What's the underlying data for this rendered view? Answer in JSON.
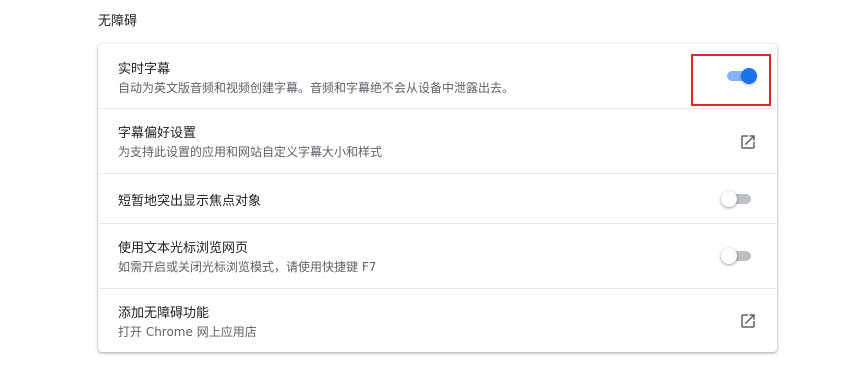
{
  "section": {
    "title": "无障碍"
  },
  "rows": [
    {
      "title": "实时字幕",
      "subtitle": "自动为英文版音频和视频创建字幕。音频和字幕绝不会从设备中泄露出去。",
      "control": "toggle",
      "enabled": true
    },
    {
      "title": "字幕偏好设置",
      "subtitle": "为支持此设置的应用和网站自定义字幕大小和样式",
      "control": "external-link-icon"
    },
    {
      "title": "短暂地突出显示焦点对象",
      "subtitle": "",
      "control": "toggle",
      "enabled": false
    },
    {
      "title": "使用文本光标浏览网页",
      "subtitle": "如需开启或关闭光标浏览模式，请使用快捷键 F7",
      "control": "toggle",
      "enabled": false
    },
    {
      "title": "添加无障碍功能",
      "subtitle": "打开 Chrome 网上应用店",
      "control": "external-link-icon"
    }
  ],
  "colors": {
    "accent": "#1a73e8",
    "accent_track": "#8ab4f8",
    "highlight_border": "#e0282e",
    "secondary_text": "#5f6368"
  }
}
